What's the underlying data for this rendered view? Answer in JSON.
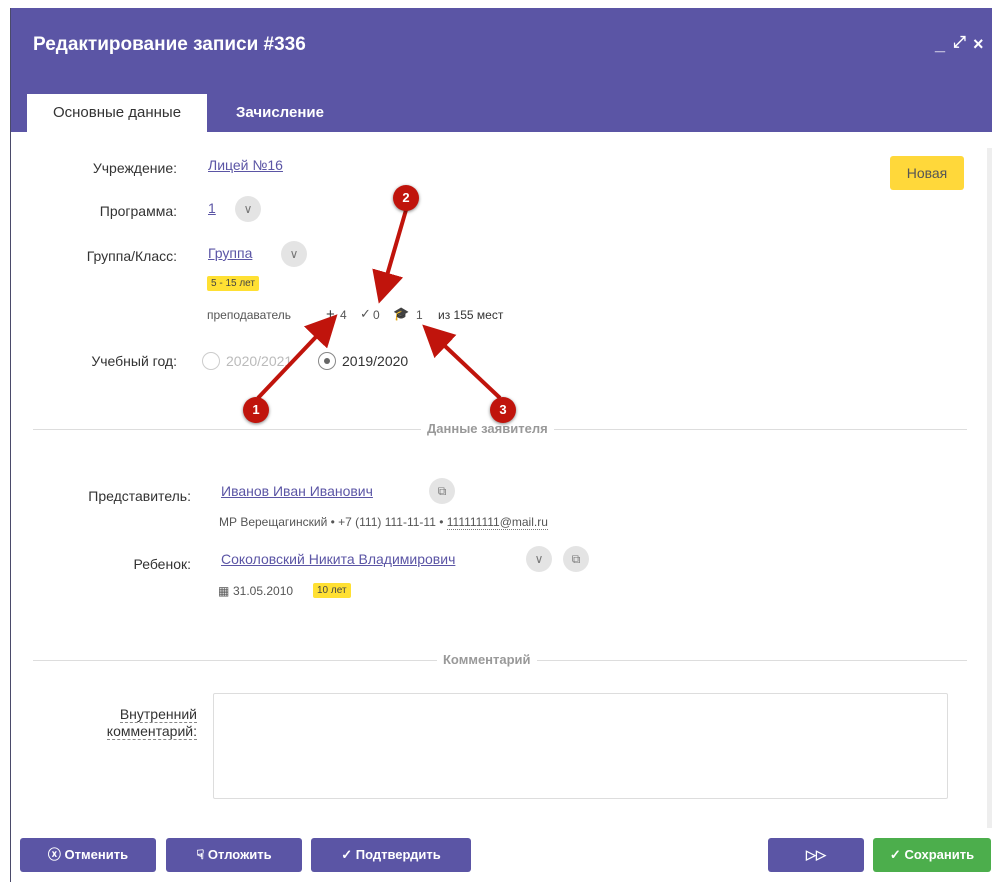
{
  "window": {
    "title": "Редактирование записи #336",
    "controls": {
      "minimize": "_",
      "maximize": "⤢",
      "close": "×"
    }
  },
  "tabs": [
    {
      "label": "Основные данные",
      "active": true
    },
    {
      "label": "Зачисление",
      "active": false
    }
  ],
  "status_badge": "Новая",
  "fields": {
    "institution_label": "Учреждение:",
    "institution_value": "Лицей №16",
    "program_label": "Программа:",
    "program_value": "1",
    "group_label": "Группа/Класс:",
    "group_value": "Группа",
    "age_badge": "5 - 15 лет",
    "teacher_text": "преподаватель",
    "stats": {
      "plus": "4",
      "check": "0",
      "cap": "1"
    },
    "capacity_text": "из 155 мест",
    "year_label": "Учебный год:",
    "year_options": [
      "2020/2021",
      "2019/2020"
    ],
    "year_selected": "2019/2020"
  },
  "applicant_section": {
    "title": "Данные заявителя",
    "representative_label": "Представитель:",
    "representative_name": "Иванов Иван Иванович",
    "representative_details": "МР Верещагинский • +7 (111) 111-11-11 • ",
    "representative_email": "111111111@mail.ru",
    "child_label": "Ребенок:",
    "child_name": "Соколовский Никита Владимирович",
    "child_birthdate": "31.05.2010",
    "child_age": "10 лет"
  },
  "comment_section": {
    "title": "Комментарий",
    "internal_label_line1": "Внутренний",
    "internal_label_line2": "комментарий:",
    "internal_value": ""
  },
  "footer": {
    "cancel": "Отменить",
    "postpone": "Отложить",
    "confirm": "Подтвердить",
    "next": "▷▷",
    "save": "Сохранить"
  },
  "annotations": [
    "1",
    "2",
    "3"
  ],
  "colors": {
    "primary": "#5b55a5",
    "accent_yellow": "#ffd83a",
    "save_green": "#4cae4c",
    "annotation_red": "#c0140c"
  }
}
